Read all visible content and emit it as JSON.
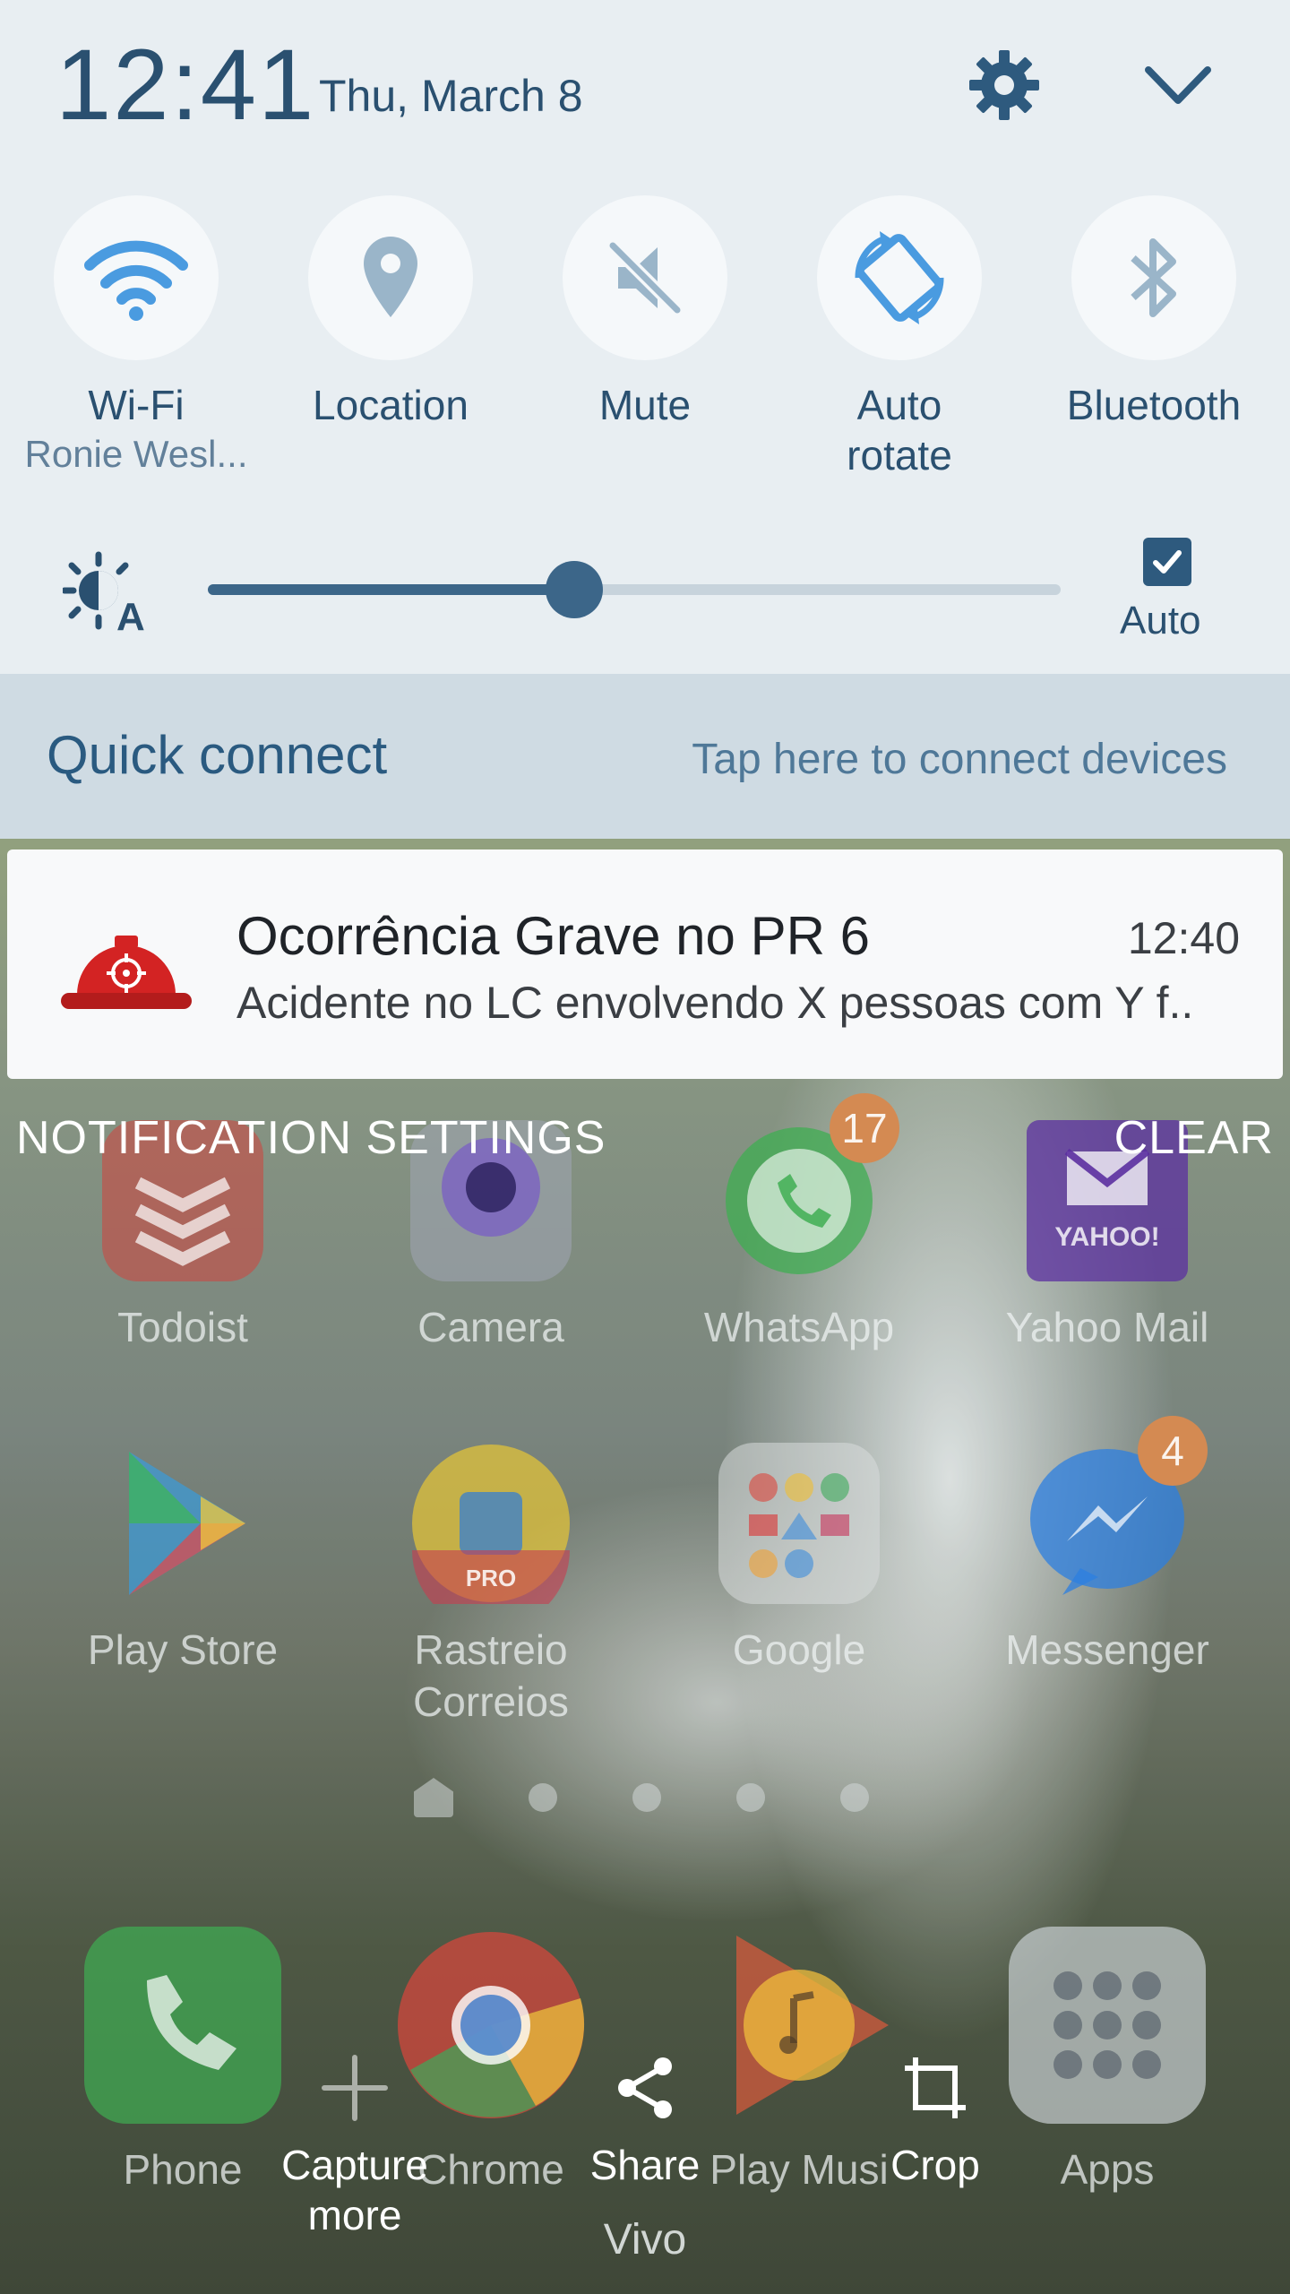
{
  "status": {
    "time": "12:41",
    "date": "Thu, March 8"
  },
  "toggles": [
    {
      "label": "Wi-Fi",
      "sub": "Ronie Wesl...",
      "icon": "wifi-icon"
    },
    {
      "label": "Location",
      "sub": "",
      "icon": "location-icon"
    },
    {
      "label": "Mute",
      "sub": "",
      "icon": "mute-icon"
    },
    {
      "label": "Auto",
      "label2": "rotate",
      "icon": "auto-rotate-icon"
    },
    {
      "label": "Bluetooth",
      "sub": "",
      "icon": "bluetooth-icon"
    }
  ],
  "brightness": {
    "level": 0.43,
    "auto_label": "Auto",
    "auto_checked": true
  },
  "quick_connect": {
    "title": "Quick connect",
    "hint": "Tap here to connect devices"
  },
  "notification": {
    "title": "Ocorrência Grave no PR 6",
    "time": "12:40",
    "body": "Acidente no LC envolvendo X pessoas com Y f.."
  },
  "notification_actions": {
    "settings": "NOTIFICATION SETTINGS",
    "clear": "CLEAR"
  },
  "home_apps": [
    {
      "label": "Todoist",
      "color": "#c94a43"
    },
    {
      "label": "Camera",
      "color": "#8f95a8"
    },
    {
      "label": "WhatsApp",
      "color": "#3fae52",
      "badge": "17"
    },
    {
      "label": "Yahoo Mail",
      "color": "#5b2fa0"
    },
    {
      "label": "Play Store",
      "color": "#3e9ad4"
    },
    {
      "label": "Rastreio",
      "label2": "Correios",
      "color": "#e0c23a"
    },
    {
      "label": "Google",
      "color": "#d8dcdc"
    },
    {
      "label": "Messenger",
      "color": "#2c7fe0",
      "badge": "4"
    }
  ],
  "dock": {
    "phone": "Phone",
    "chrome": "Chrome",
    "play_music": "Play Musi",
    "apps": "Apps"
  },
  "yahoo_text": "YAHOO!",
  "rastreio_badge": "PRO",
  "toolbar": {
    "capture": "Capture",
    "capture2": "more",
    "share": "Share",
    "crop": "Crop",
    "carrier": "Vivo"
  }
}
